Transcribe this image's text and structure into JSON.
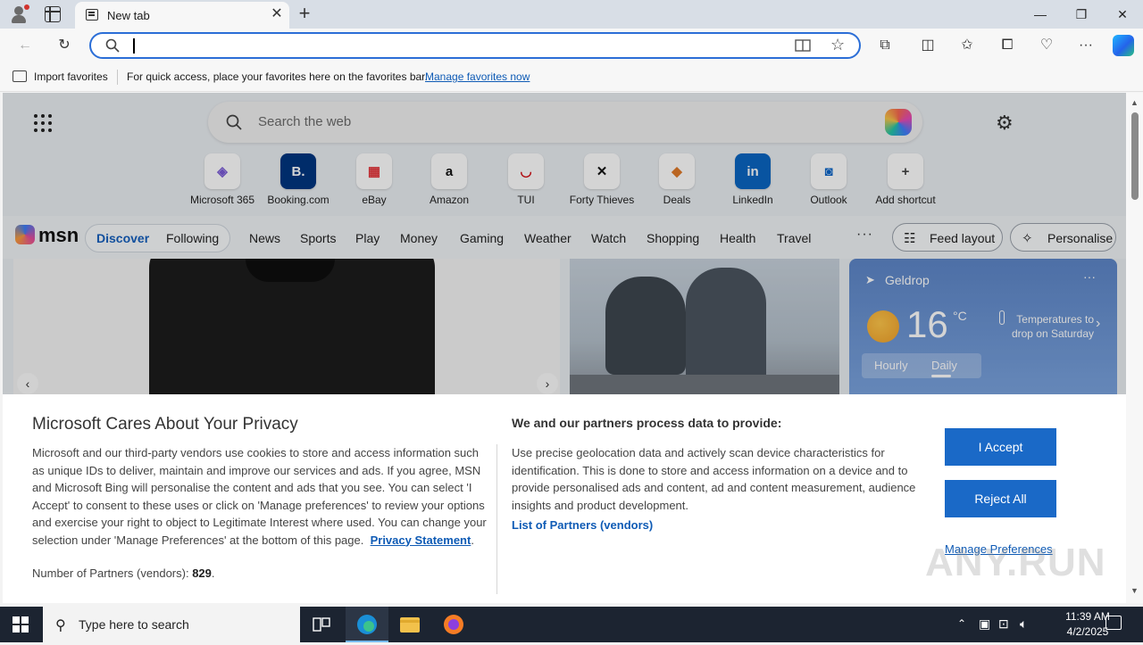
{
  "browser": {
    "tab_title": "New tab",
    "address_value": "",
    "favorites_bar": {
      "import_label": "Import favorites",
      "message": "For quick access, place your favorites here on the favorites bar.",
      "link": "Manage favorites now"
    }
  },
  "newtab": {
    "search_placeholder": "Search the web",
    "shortcuts": [
      {
        "label": "Microsoft 365",
        "icon": "microsoft-365-icon",
        "glyph": "◈",
        "color": "#7b5cd6"
      },
      {
        "label": "Booking.com",
        "icon": "booking-icon",
        "glyph": "B.",
        "color": "#ffffff",
        "bg": "#003580"
      },
      {
        "label": "eBay",
        "icon": "ebay-icon",
        "glyph": "▦",
        "color": "#e53238"
      },
      {
        "label": "Amazon",
        "icon": "amazon-icon",
        "glyph": "a",
        "color": "#111111"
      },
      {
        "label": "TUI",
        "icon": "tui-icon",
        "glyph": "◡",
        "color": "#d40e14"
      },
      {
        "label": "Forty Thieves",
        "icon": "forty-thieves-icon",
        "glyph": "✕",
        "color": "#111111"
      },
      {
        "label": "Deals",
        "icon": "deals-icon",
        "glyph": "◆",
        "color": "#e07a2a"
      },
      {
        "label": "LinkedIn",
        "icon": "linkedin-icon",
        "glyph": "in",
        "color": "#ffffff",
        "bg": "#0a66c2"
      },
      {
        "label": "Outlook",
        "icon": "outlook-icon",
        "glyph": "◙",
        "color": "#0a64c8"
      },
      {
        "label": "Add shortcut",
        "icon": "plus-icon",
        "glyph": "+",
        "color": "#444444"
      }
    ]
  },
  "msn": {
    "logo_text": "msn",
    "segments": {
      "discover": "Discover",
      "following": "Following"
    },
    "nav": [
      "News",
      "Sports",
      "Play",
      "Money",
      "Gaming",
      "Weather",
      "Watch",
      "Shopping",
      "Health",
      "Travel"
    ],
    "more": "···",
    "feed_layout": "Feed layout",
    "personalise": "Personalise"
  },
  "weather": {
    "location": "Geldrop",
    "temperature": "16",
    "unit": "°C",
    "alert": "Temperatures to drop on Saturday",
    "tab_hourly": "Hourly",
    "tab_daily": "Daily"
  },
  "privacy": {
    "title": "Microsoft Cares About Your Privacy",
    "body": "Microsoft and our third-party vendors use cookies to store and access information such as unique IDs to deliver, maintain and improve our services and ads. If you agree, MSN and Microsoft Bing will personalise the content and ads that you see. You can select 'I Accept' to consent to these uses or click on 'Manage preferences' to review your options and exercise your right to object to Legitimate Interest where used.  You can change your selection under 'Manage Preferences' at the bottom of this page.",
    "privacy_link": "Privacy Statement",
    "partners_label": "Number of Partners (vendors):",
    "partners_count": "829",
    "right_title": "We and our partners process data to provide:",
    "right_body": "Use precise geolocation data and actively scan device characteristics for identification. This is done to store and access information on a device and to provide personalised ads and content, ad and content measurement, audience insights and product development.",
    "list_link": "List of Partners (vendors)",
    "accept": "I Accept",
    "reject": "Reject All",
    "manage": "Manage Preferences"
  },
  "watermark": "ANY.RUN",
  "taskbar": {
    "search_placeholder": "Type here to search",
    "time": "11:39 AM",
    "date": "4/2/2025"
  }
}
